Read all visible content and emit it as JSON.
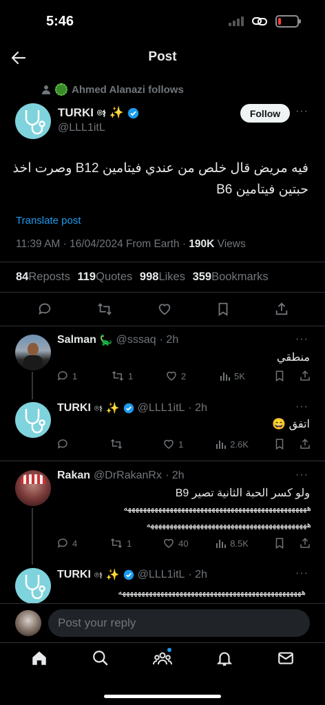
{
  "status_bar": {
    "time": "5:46",
    "battery_level": 0.15
  },
  "header": {
    "title": "Post"
  },
  "post": {
    "social_context": "Ahmed Alanazi follows",
    "author_name": "TURKI",
    "author_handle": "@LLL1itL",
    "follow_label": "Follow",
    "text_line1": "فيه مريض قال خلص من عندي فيتامين B12 وصرت اخذ",
    "text_line2": "حبتين فيتامين B6",
    "translate_label": "Translate post",
    "meta_time": "11:39 AM · 16/04/2024 From Earth · ",
    "meta_views": "190K",
    "meta_views_label": " Views",
    "reposts": "84",
    "reposts_label": "Reposts",
    "quotes": "119",
    "quotes_label": "Quotes",
    "likes": "998",
    "likes_label": "Likes",
    "bookmarks": "359",
    "bookmarks_label": "Bookmarks"
  },
  "replies": [
    {
      "name": "Salman",
      "handle": "@sssaq",
      "time": "· 2h",
      "text": "منطقي",
      "replies": "1",
      "reposts": "1",
      "likes": "2",
      "views": "5K"
    },
    {
      "name": "TURKI",
      "handle": "@LLL1itL",
      "time": "· 2h",
      "text": "اتفق 😄",
      "replies": "",
      "reposts": "",
      "likes": "1",
      "views": "2.6K"
    },
    {
      "name": "Rakan",
      "handle": "@DrRakanRx",
      "time": "· 2h",
      "text": "ولو كسر الحبة الثانية تصير B9",
      "glyph_line1": "ههههههههههههههههههههههههههههههههههههههههههههههههه",
      "glyph_line2": "ههههههههههههههههههههههههههههههههههههههههههه",
      "replies": "4",
      "reposts": "1",
      "likes": "40",
      "views": "8.5K"
    },
    {
      "name": "TURKI",
      "handle": "@LLL1itL",
      "time": "· 2h",
      "glyph_line1": "ههههههههههههههههههههههههههههههههههههههههههههههههه"
    }
  ],
  "reply_box": {
    "placeholder": "Post your reply"
  },
  "nav": [
    "home-icon",
    "search-icon",
    "communities-icon",
    "notifications-icon",
    "messages-icon"
  ],
  "colors": {
    "accent": "#1d9bf0",
    "background": "#000000",
    "battery": "#ff3b30"
  }
}
